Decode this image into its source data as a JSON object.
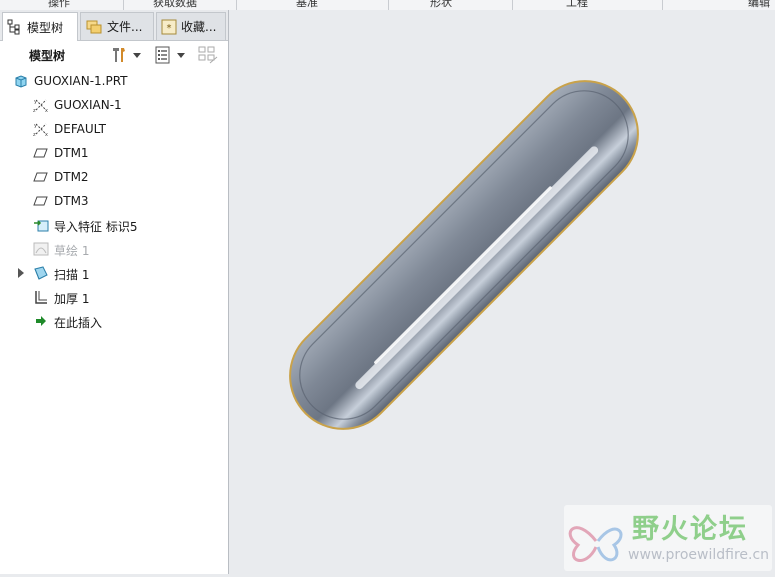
{
  "top_menu": {
    "items": [
      "操作",
      "获取数据",
      "基准",
      "形状",
      "工程",
      "编辑"
    ]
  },
  "tabs": [
    {
      "label": "模型树",
      "icon": "model-tree-icon"
    },
    {
      "label": "文件...",
      "icon": "folder-icon"
    },
    {
      "label": "收藏...",
      "icon": "favorites-icon"
    }
  ],
  "toolbar": {
    "title": "模型树",
    "icons": [
      "tools-icon",
      "settings-icon",
      "columns-icon"
    ]
  },
  "tree": {
    "root": "GUOXIAN-1.PRT",
    "items": [
      {
        "label": "GUOXIAN-1",
        "icon": "csys-icon"
      },
      {
        "label": "DEFAULT",
        "icon": "csys-icon"
      },
      {
        "label": "DTM1",
        "icon": "datum-plane-icon"
      },
      {
        "label": "DTM2",
        "icon": "datum-plane-icon"
      },
      {
        "label": "DTM3",
        "icon": "datum-plane-icon"
      },
      {
        "label": "导入特征 标识5",
        "icon": "import-feature-icon"
      },
      {
        "label": "草绘 1",
        "icon": "sketch-icon",
        "suppressed": true
      },
      {
        "label": "扫描 1",
        "icon": "sweep-icon",
        "expandable": true
      },
      {
        "label": "加厚 1",
        "icon": "thicken-icon"
      },
      {
        "label": "在此插入",
        "icon": "insert-here-arrow-icon"
      }
    ]
  },
  "watermark": {
    "title": "野火论坛",
    "url": "www.proewildfire.cn"
  },
  "colors": {
    "panel_bg": "#ffffff",
    "viewport_bg": "#e9ebee",
    "model": "#8c96a4",
    "edge": "#c9a24a",
    "insert_arrow": "#1f8a2a",
    "watermark_green": "#8fcf8b"
  }
}
